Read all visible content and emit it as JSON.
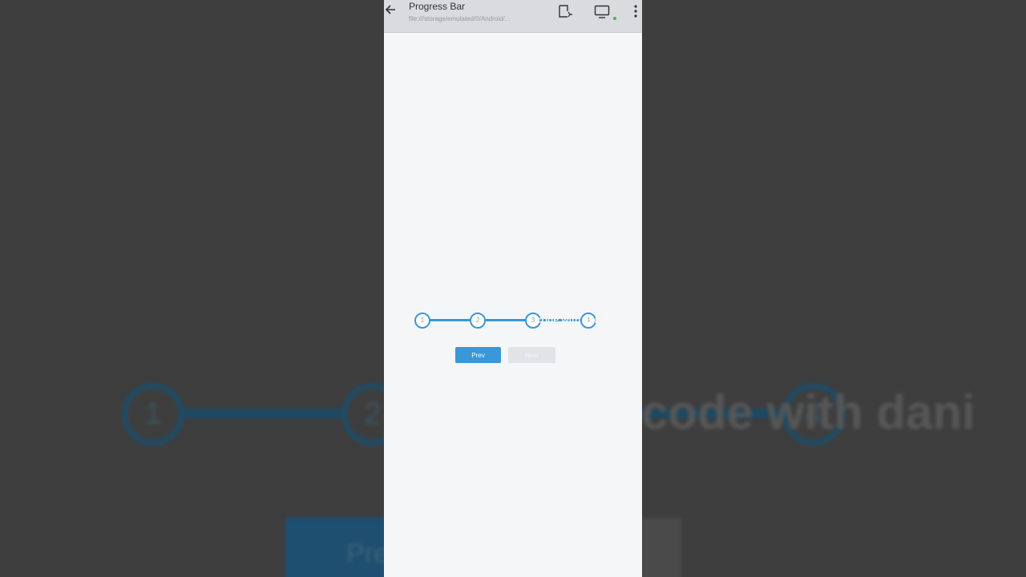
{
  "browser": {
    "title": "Progress Bar",
    "url": "file:///storage/emulated/0/Android/..."
  },
  "progress": {
    "steps": [
      "1",
      "2",
      "3",
      "4"
    ],
    "active_step": 4,
    "accent_color": "#3a98d8"
  },
  "buttons": {
    "prev_label": "Prev",
    "next_label": "Next"
  },
  "watermark": "code with dani",
  "background_zoom": {
    "step_labels": [
      "1",
      "2",
      "4"
    ],
    "button_label": "Pre"
  },
  "icons": {
    "back": "arrow-left-icon",
    "cast": "cast-icon",
    "screen": "monitor-icon",
    "menu": "kebab-menu-icon"
  }
}
